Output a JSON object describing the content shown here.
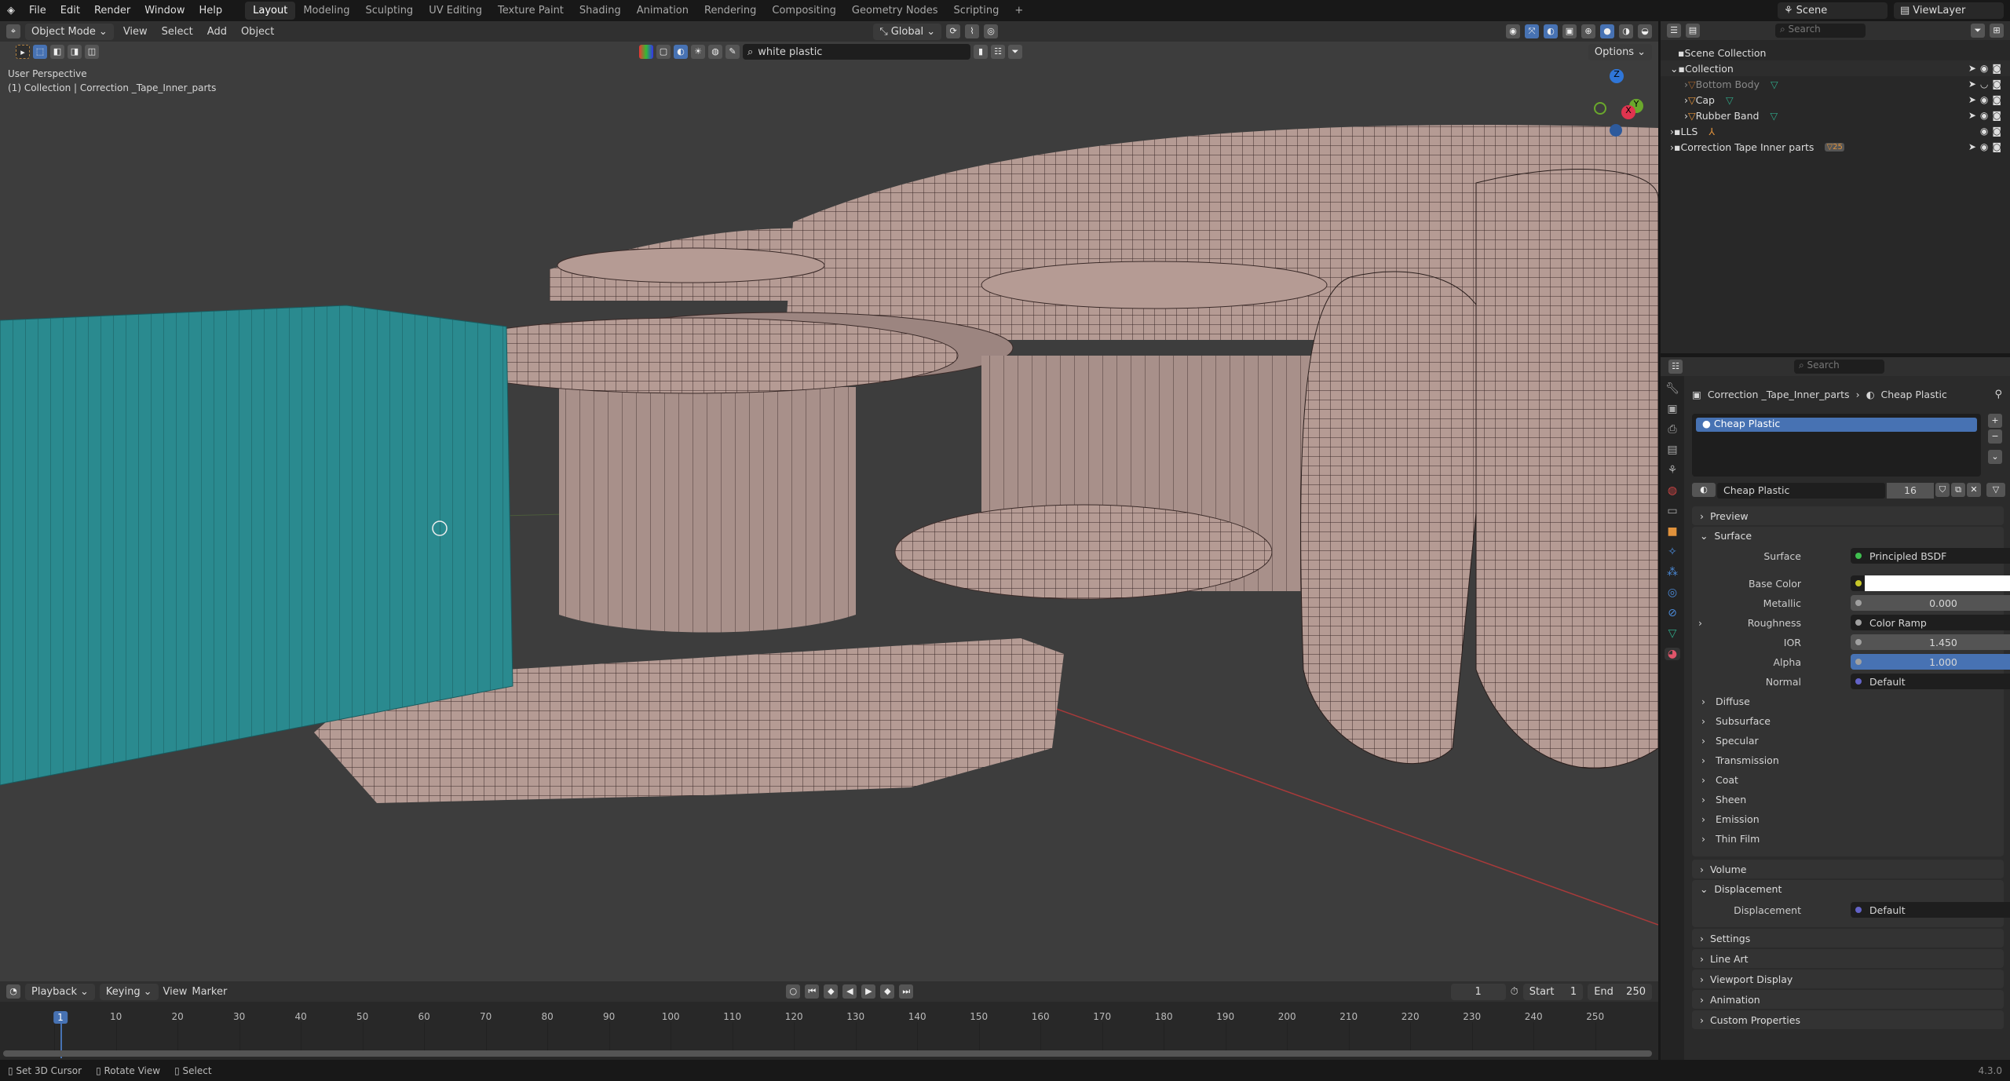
{
  "menu": [
    "File",
    "Edit",
    "Render",
    "Window",
    "Help"
  ],
  "workspaces": [
    "Layout",
    "Modeling",
    "Sculpting",
    "UV Editing",
    "Texture Paint",
    "Shading",
    "Animation",
    "Rendering",
    "Compositing",
    "Geometry Nodes",
    "Scripting"
  ],
  "active_workspace": "Layout",
  "scene": "Scene",
  "view_layer": "ViewLayer",
  "viewport_header": {
    "mode": "Object Mode",
    "menus": [
      "View",
      "Select",
      "Add",
      "Object"
    ],
    "orientation": "Global",
    "options": "Options",
    "asset_search": "white plastic"
  },
  "overlay_text": {
    "perspective": "User Perspective",
    "context": "(1) Collection | Correction _Tape_Inner_parts"
  },
  "gizmo": {
    "z": "Z",
    "y": "Y",
    "x": "X"
  },
  "outliner": {
    "search_placeholder": "Search",
    "items": [
      {
        "label": "Scene Collection"
      },
      {
        "label": "Collection"
      },
      {
        "label": "Bottom Body"
      },
      {
        "label": "Cap"
      },
      {
        "label": "Rubber Band"
      },
      {
        "label": "LLS"
      },
      {
        "label": "Correction Tape Inner parts",
        "badge": "25"
      }
    ]
  },
  "properties": {
    "search_placeholder": "Search",
    "breadcrumb_object": "Correction _Tape_Inner_parts",
    "breadcrumb_material": "Cheap Plastic",
    "slot": "Cheap Plastic",
    "material_name": "Cheap Plastic",
    "users": "16",
    "panels": {
      "preview": "Preview",
      "surface": "Surface",
      "volume": "Volume",
      "displacement": "Displacement",
      "settings": "Settings",
      "line_art": "Line Art",
      "viewport_display": "Viewport Display",
      "animation": "Animation",
      "custom_properties": "Custom Properties"
    },
    "surface_rows": [
      {
        "label": "Surface",
        "value": "Principled BSDF",
        "socket": "#3fbf4f"
      },
      {
        "label": "Base Color",
        "value": "",
        "socket": "#c7c729",
        "color": "#ffffff"
      },
      {
        "label": "Metallic",
        "value": "0.000",
        "socket": "#a0a0a0"
      },
      {
        "label": "Roughness",
        "value": "Color Ramp",
        "socket": "#a0a0a0"
      },
      {
        "label": "IOR",
        "value": "1.450",
        "socket": "#a0a0a0"
      },
      {
        "label": "Alpha",
        "value": "1.000",
        "socket": "#a0a0a0"
      },
      {
        "label": "Normal",
        "value": "Default",
        "socket": "#6363c7"
      }
    ],
    "subpanels": [
      "Diffuse",
      "Subsurface",
      "Specular",
      "Transmission",
      "Coat",
      "Sheen",
      "Emission",
      "Thin Film"
    ],
    "displacement_row": {
      "label": "Displacement",
      "value": "Default"
    }
  },
  "timeline": {
    "menus": [
      "Playback",
      "Keying",
      "View",
      "Marker"
    ],
    "current_frame": "1",
    "start_label": "Start",
    "start": "1",
    "end_label": "End",
    "end": "250",
    "ticks": [
      "1",
      "10",
      "20",
      "30",
      "40",
      "50",
      "60",
      "70",
      "80",
      "90",
      "100",
      "110",
      "120",
      "130",
      "140",
      "150",
      "160",
      "170",
      "180",
      "190",
      "200",
      "210",
      "220",
      "230",
      "240",
      "250"
    ]
  },
  "status": {
    "items": [
      "Set 3D Cursor",
      "Rotate View",
      "Select"
    ],
    "version": "4.3.0"
  },
  "colors": {
    "accent": "#4772b3",
    "teal": "#2a8a8f",
    "mesh": "#b8a09a"
  }
}
